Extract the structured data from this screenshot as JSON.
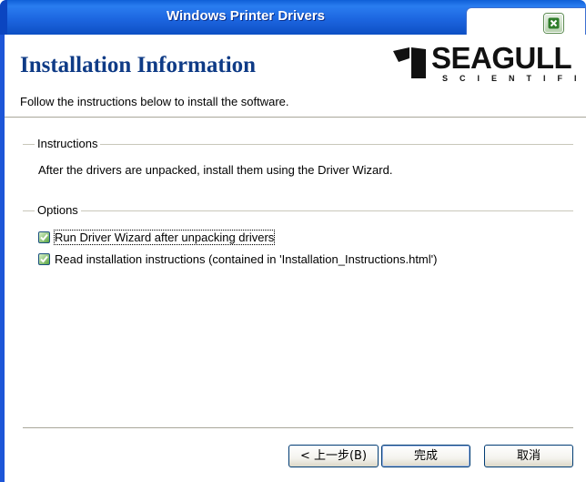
{
  "window": {
    "title": "Windows Printer Drivers",
    "close_icon": "close-icon"
  },
  "header": {
    "title": "Installation Information",
    "description": "Follow the instructions below to install the software.",
    "logo": {
      "name": "SEAGULL",
      "sub": "SCIENTIFIC"
    }
  },
  "instructions": {
    "group_label": "Instructions",
    "text": "After the drivers are unpacked, install them using the Driver Wizard."
  },
  "options": {
    "group_label": "Options",
    "items": [
      {
        "label": "Run Driver Wizard after unpacking drivers",
        "checked": true
      },
      {
        "label": "Read installation instructions (contained in 'Installation_Instructions.html')",
        "checked": true
      }
    ]
  },
  "buttons": {
    "back": "< 上一步(B)",
    "finish": "完成",
    "cancel": "取消"
  },
  "colors": {
    "titlebar": "#1d66e0",
    "heading": "#0f3b86"
  }
}
